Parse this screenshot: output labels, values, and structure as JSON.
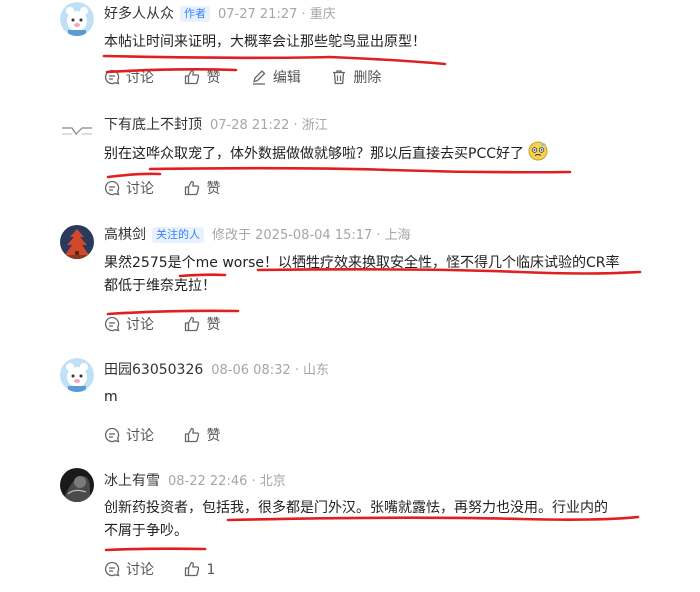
{
  "comments": [
    {
      "name": "好多人从众",
      "badge": "作者",
      "meta": "07-27 21:27 · 重庆",
      "text": "本帖让时间来证明，大概率会让那些鸵鸟显出原型！",
      "actions": {
        "discuss": "讨论",
        "like": "赞",
        "edit": "编辑",
        "delete": "删除"
      }
    },
    {
      "name": "下有底上不封顶",
      "meta": "07-28 21:22 · 浙江",
      "text": "别在这哗众取宠了，体外数据做做就够啦？那以后直接去买PCC好了",
      "actions": {
        "discuss": "讨论",
        "like": "赞"
      }
    },
    {
      "name": "高棋剑",
      "badge": "关注的人",
      "meta": "修改于 2025-08-04 15:17 · 上海",
      "text_line1": "果然2575是个me worse！以牺牲疗效来换取安全性，怪不得几个临床试验的CR率",
      "text_line2": "都低于维奈克拉！",
      "actions": {
        "discuss": "讨论",
        "like": "赞"
      }
    },
    {
      "name": "田园63050326",
      "meta": "08-06 08:32 · 山东",
      "text": "m",
      "actions": {
        "discuss": "讨论",
        "like": "赞"
      }
    },
    {
      "name": "冰上有雪",
      "meta": "08-22 22:46 · 北京",
      "text_line1": "创新药投资者，包括我，很多都是门外汉。张嘴就露怯，再努力也没用。行业内的",
      "text_line2": "不屑于争吵。",
      "actions": {
        "discuss": "讨论",
        "like": "1"
      }
    }
  ],
  "colors": {
    "underline": "#e02020",
    "badge_text": "#3b82f6",
    "badge_bg": "#e8f1fe",
    "meta": "#a6a6a6"
  }
}
